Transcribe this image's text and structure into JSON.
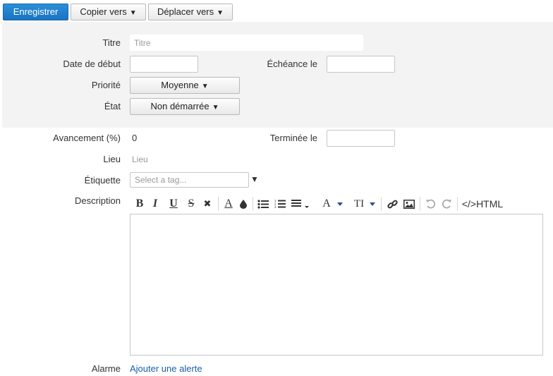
{
  "toolbar": {
    "save_label": "Enregistrer",
    "copy_label": "Copier vers",
    "move_label": "Déplacer vers"
  },
  "form": {
    "title_label": "Titre",
    "title_placeholder": "Titre",
    "start_label": "Date de début",
    "start_value": "",
    "due_label": "Échéance le",
    "due_value": "",
    "priority_label": "Priorité",
    "priority_value": "Moyenne",
    "state_label": "État",
    "state_value": "Non démarrée",
    "progress_label": "Avancement (%)",
    "progress_value": "0",
    "done_label": "Terminée le",
    "done_value": "",
    "location_label": "Lieu",
    "location_placeholder": "Lieu",
    "tag_label": "Étiquette",
    "tag_placeholder": "Select a tag...",
    "description_label": "Description",
    "alarm_label": "Alarme",
    "alarm_link": "Ajouter une alerte"
  },
  "editor_toolbar": {
    "bold": "B",
    "italic": "I",
    "underline": "U",
    "strike": "S",
    "clear": "✖",
    "font_color": "A",
    "font_name": "A",
    "font_size": "TI",
    "html_label": "</>HTML"
  },
  "colors": {
    "primary": "#1a73c1",
    "panel": "#f3f3f3",
    "link": "#1b5ea8"
  }
}
